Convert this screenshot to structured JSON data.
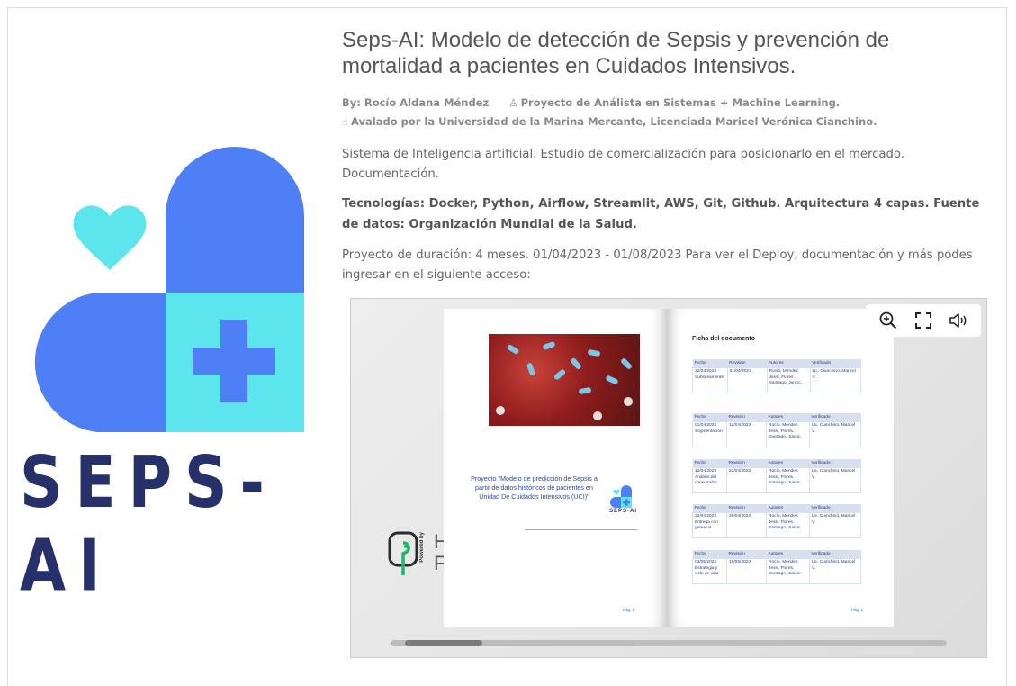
{
  "brand": {
    "logo_word": "SEPS-AI",
    "colors": {
      "blue": "#4f7ff5",
      "cyan": "#5ce5ed",
      "navy": "#26306b"
    }
  },
  "header": {
    "title": "Seps-AI: Modelo de detección de Sepsis y prevención de mortalidad a pacientes en Cuidados Intensivos."
  },
  "meta": {
    "author": "By: Rocío Aldana Méndez",
    "project_icon": "award-icon",
    "project": "Proyecto de Análista en Sistemas + Machine Learning.",
    "endorse_icon": "thumbs-up-icon",
    "endorsement": "Avalado por la Universidad de la Marina Mercante, Licenciada Maricel Verónica Cianchino."
  },
  "body": {
    "description": "Sistema de Inteligencia artificial. Estudio de comercialización para posicionarlo en el mercado. Documentación.",
    "technologies": "Tecnologías: Docker, Python, Airflow, Streamlit, AWS, Git, Github. Arquitectura 4 capas. Fuente de datos: Organización Mundial de la Salud.",
    "duration": "Proyecto de duración: 4 meses. 01/04/2023 - 01/08/2023 Para ver el Deploy, documentación y más podes ingresar en el siguiente acceso:"
  },
  "viewer": {
    "toolbar": [
      "zoom-in-icon",
      "fullscreen-icon",
      "volume-icon"
    ],
    "powered_by": "Powered by",
    "powered_brand_partial": "H\nF",
    "left_page": {
      "cover_text": "Proyecto \"Modelo de predicción de Sepsis a partir de datos históricos de pacientes en Unidad De Cuidados Intensivos (UCI)\"",
      "mini_logo_word": "SEPS-AI",
      "page_label": "Pág. 1"
    },
    "right_page": {
      "heading": "Ficha del documento",
      "page_label": "Pág. 2",
      "headers": [
        "Fecha",
        "Revisión",
        "Autores",
        "Verificado"
      ],
      "rows": [
        {
          "date": "22/03/2023",
          "detail": "Subsesamenter",
          "rev": "01/04/2023",
          "authors": "Rocío, Méndez. Jessi, Flores. Santiago, Juricic.",
          "verified": "Lic. Cianchino, Maricel V."
        },
        {
          "date": "01/04/2023",
          "detail": "Segmentación",
          "rev": "12/04/2023",
          "authors": "Rocío, Méndez. Jessi, Flores. Santiago, Juricic.",
          "verified": "Lic. Cianchino, Maricel V."
        },
        {
          "date": "12/04/2023",
          "detail": "Análisis del consumidor",
          "rev": "22/04/2023",
          "authors": "Rocío, Méndez. Jessi, Flores. Santiago, Juricic.",
          "verified": "Lic. Cianchino, Maricel V."
        },
        {
          "date": "22/04/2023",
          "detail": "Entrega con gerencia",
          "rev": "28/04/2023",
          "authors": "Rocío, Méndez. Jessi, Flores. Santiago, Juricic.",
          "verified": "Lic. Cianchino, Maricel V."
        },
        {
          "date": "03/05/2023",
          "detail": "Estrategia y ciclo de vida",
          "rev": "18/05/2023",
          "authors": "Rocío, Méndez. Jessi, Flores. Santiago, Juricic.",
          "verified": "Lic. Cianchino, Maricel V."
        }
      ]
    },
    "scroll_position": 0.05
  }
}
